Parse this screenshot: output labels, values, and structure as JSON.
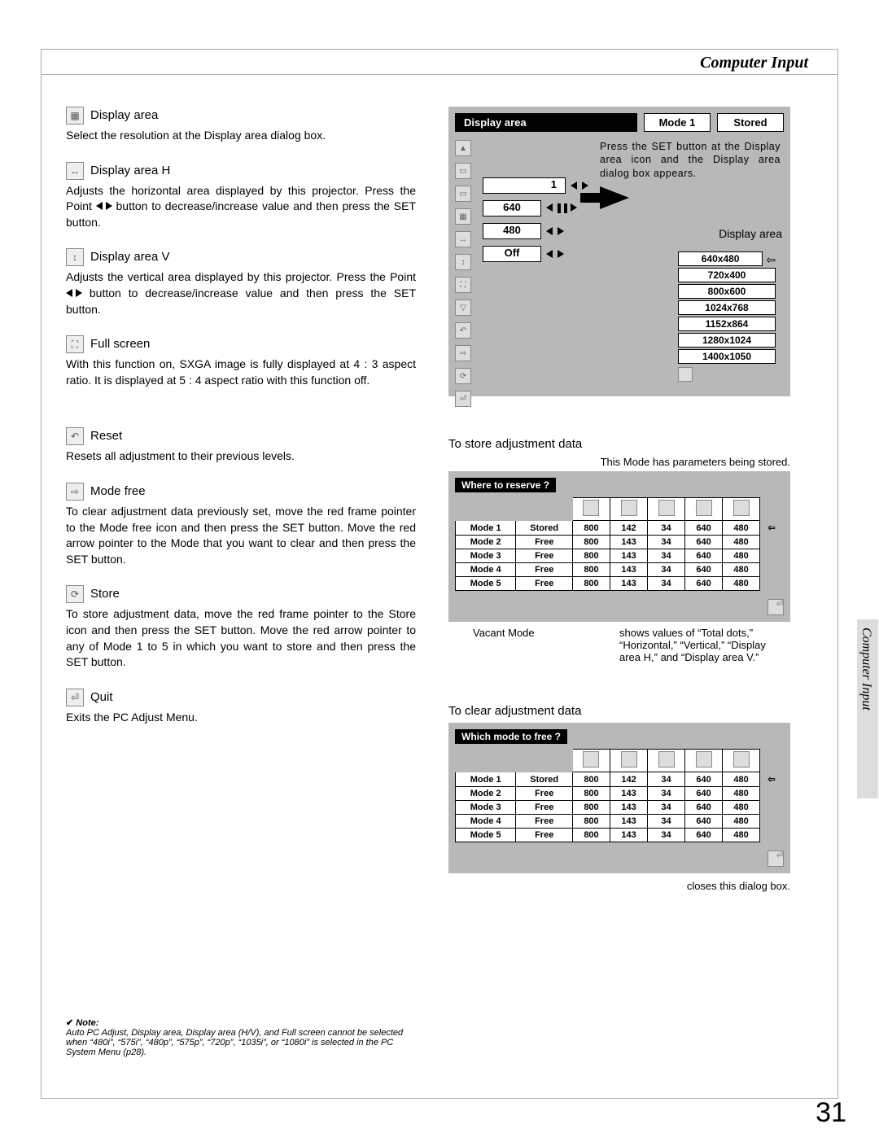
{
  "header": {
    "section_title": "Computer Input"
  },
  "side_tab": "Computer Input",
  "page_number": "31",
  "items": {
    "display_area": {
      "title": "Display area",
      "body": "Select the resolution at the Display area dialog box."
    },
    "display_area_h": {
      "title": "Display area H",
      "body_pre": "Adjusts the horizontal area displayed by this projector.  Press the Point ",
      "body_post": " button to decrease/increase value and then press the SET button."
    },
    "display_area_v": {
      "title": "Display area V",
      "body_pre": "Adjusts the vertical area displayed by this projector.  Press the Point ",
      "body_post": " button to decrease/increase value and then press the SET button."
    },
    "full_screen": {
      "title": "Full screen",
      "body": "With this function on, SXGA image is fully displayed at 4 : 3 aspect ratio.  It is displayed at 5 : 4 aspect ratio with this function off."
    },
    "reset": {
      "title": "Reset",
      "body": "Resets all adjustment to their previous levels."
    },
    "mode_free": {
      "title": "Mode free",
      "body": "To clear adjustment data previously set, move the red frame pointer to the Mode free icon and then press the SET button.  Move the red arrow pointer to the Mode that you want to clear and then press the SET button."
    },
    "store": {
      "title": "Store",
      "body": "To store adjustment data, move the red frame pointer to the Store icon and then press the SET button.  Move the red arrow pointer to any of Mode 1 to 5 in which you want to store and then press the SET button."
    },
    "quit": {
      "title": "Quit",
      "body": "Exits the PC Adjust Menu."
    }
  },
  "fig1": {
    "title": "Display area",
    "mode_label": "Mode 1",
    "status_label": "Stored",
    "annot": "Press the SET button at the Display area icon and the Display area dialog box appears.",
    "popup_title": "Display area",
    "value1": "1",
    "value640": "640",
    "value480": "480",
    "valueOff": "Off",
    "resolutions": [
      "640x480",
      "720x400",
      "800x600",
      "1024x768",
      "1152x864",
      "1280x1024",
      "1400x1050"
    ]
  },
  "store_table": {
    "section_title": "To store adjustment data",
    "sub_annot": "This Mode has parameters being stored.",
    "title": "Where to reserve ?",
    "rows": [
      {
        "mode": "Mode 1",
        "status": "Stored",
        "c1": "800",
        "c2": "142",
        "c3": "34",
        "c4": "640",
        "c5": "480",
        "sel": true
      },
      {
        "mode": "Mode 2",
        "status": "Free",
        "c1": "800",
        "c2": "143",
        "c3": "34",
        "c4": "640",
        "c5": "480"
      },
      {
        "mode": "Mode 3",
        "status": "Free",
        "c1": "800",
        "c2": "143",
        "c3": "34",
        "c4": "640",
        "c5": "480"
      },
      {
        "mode": "Mode 4",
        "status": "Free",
        "c1": "800",
        "c2": "143",
        "c3": "34",
        "c4": "640",
        "c5": "480"
      },
      {
        "mode": "Mode 5",
        "status": "Free",
        "c1": "800",
        "c2": "143",
        "c3": "34",
        "c4": "640",
        "c5": "480"
      }
    ],
    "annot_left": "Vacant Mode",
    "annot_right": "shows values of “Total dots,” “Horizontal,” “Vertical,” “Display area H,” and “Display area V.”"
  },
  "clear_table": {
    "section_title": "To clear adjustment data",
    "title": "Which mode to free ?",
    "rows": [
      {
        "mode": "Mode 1",
        "status": "Stored",
        "c1": "800",
        "c2": "142",
        "c3": "34",
        "c4": "640",
        "c5": "480",
        "sel": true
      },
      {
        "mode": "Mode 2",
        "status": "Free",
        "c1": "800",
        "c2": "143",
        "c3": "34",
        "c4": "640",
        "c5": "480"
      },
      {
        "mode": "Mode 3",
        "status": "Free",
        "c1": "800",
        "c2": "143",
        "c3": "34",
        "c4": "640",
        "c5": "480"
      },
      {
        "mode": "Mode 4",
        "status": "Free",
        "c1": "800",
        "c2": "143",
        "c3": "34",
        "c4": "640",
        "c5": "480"
      },
      {
        "mode": "Mode 5",
        "status": "Free",
        "c1": "800",
        "c2": "143",
        "c3": "34",
        "c4": "640",
        "c5": "480"
      }
    ],
    "annot": "closes this dialog box."
  },
  "note": {
    "label": "Note:",
    "body": "Auto PC Adjust, Display area, Display area (H/V), and Full screen cannot be selected when “480i”, “575i”, “480p”, “575p”, “720p”, “1035i”, or “1080i” is selected in the PC System Menu (p28)."
  }
}
